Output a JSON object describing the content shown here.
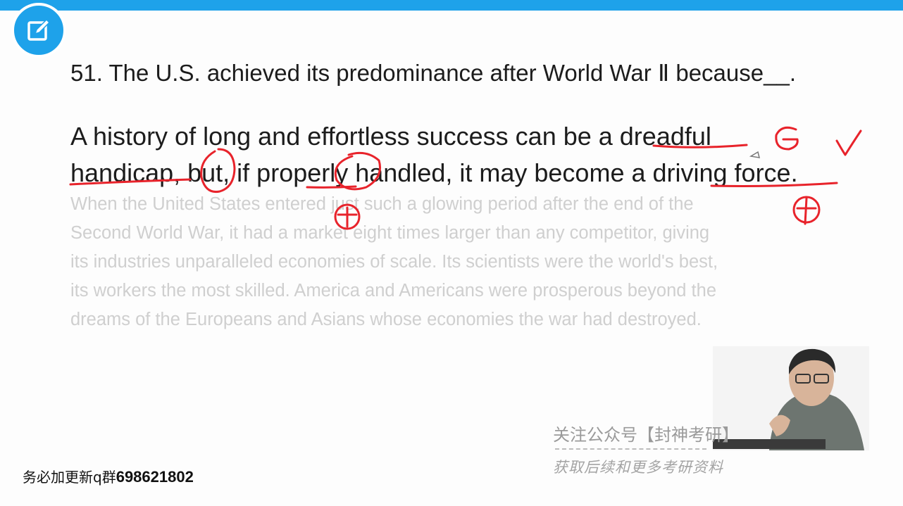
{
  "question": {
    "text": "51. The U.S. achieved its predominance after World War Ⅱ because__."
  },
  "sentence": {
    "line1": "A history of long and effortless success can be a dreadful",
    "line2": "handicap, but, if properly handled, it may become a driving force."
  },
  "passage": {
    "lines": [
      "When the United States entered just such a glowing period after the end of the",
      "Second World War, it had a market eight times larger than any competitor, giving",
      "its industries unparalleled economies of scale. Its scientists were the world's best,",
      "its workers the most skilled. America and Americans were prosperous beyond the",
      "dreams of the Europeans and Asians whose economies the war had destroyed."
    ]
  },
  "footer": {
    "prefix": "务必加更新q群",
    "number": "698621802"
  },
  "watermark": {
    "line1": "关注公众号【封神考研】",
    "line2": "获取后续和更多考研资料"
  },
  "colors": {
    "accent": "#1ea2ea",
    "annotation": "#e8232b",
    "text": "#1c1c1c",
    "faded": "#cfcfcf"
  },
  "icons": {
    "badge": "edit-note-icon"
  }
}
